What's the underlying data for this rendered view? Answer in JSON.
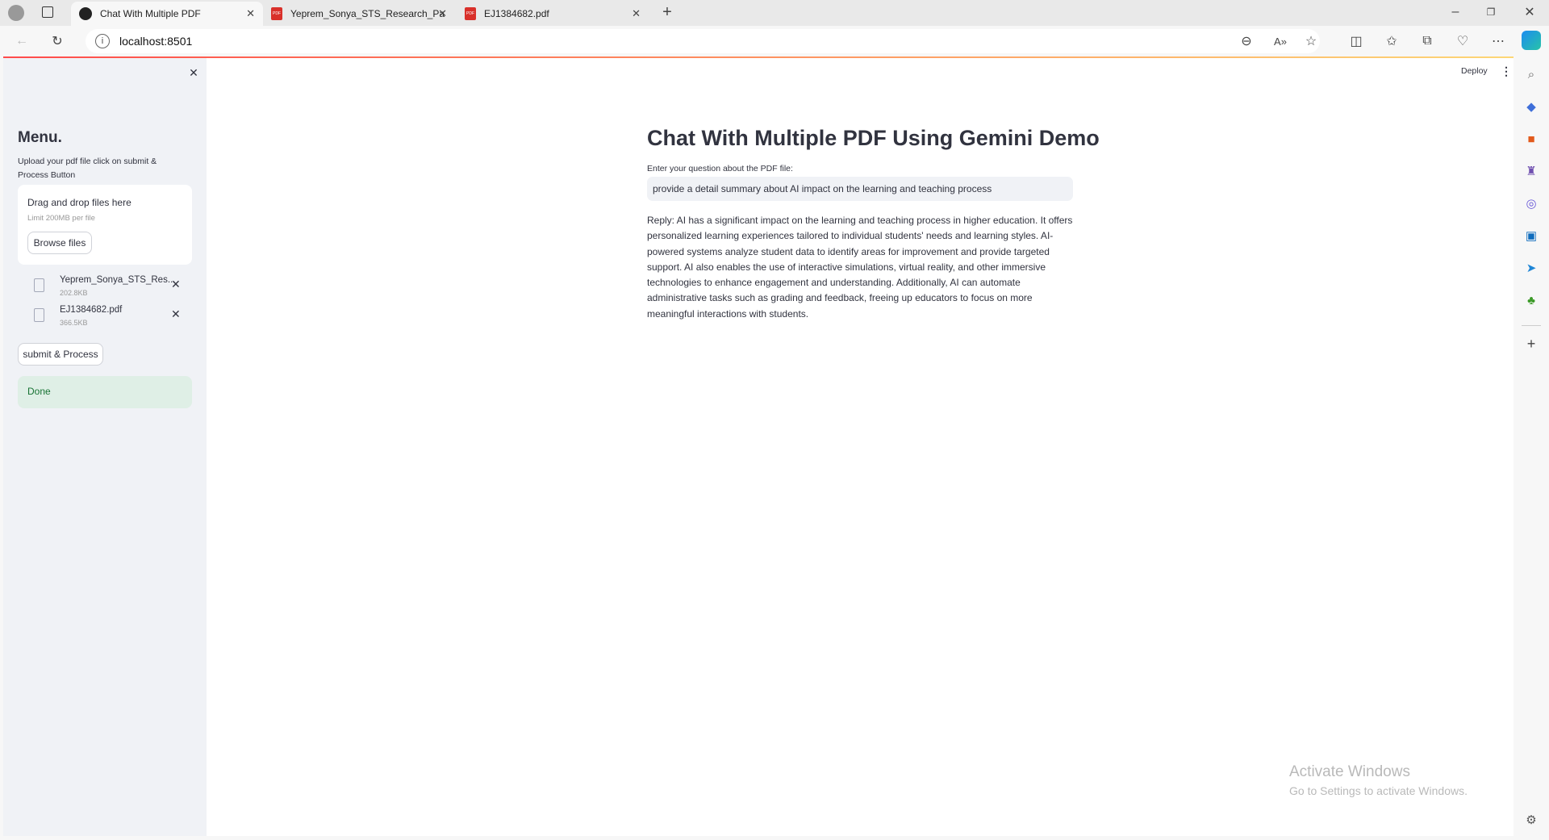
{
  "browser": {
    "tabs": [
      {
        "title": "Chat With Multiple PDF",
        "active": true
      },
      {
        "title": "Yeprem_Sonya_STS_Research_Pa",
        "active": false
      },
      {
        "title": "EJ1384682.pdf",
        "active": false
      }
    ],
    "url": "localhost:8501"
  },
  "header": {
    "deploy_label": "Deploy"
  },
  "sidebar": {
    "title": "Menu.",
    "instructions": "Upload your pdf file click on submit & Process Button",
    "uploader": {
      "drop_text": "Drag and drop files here",
      "limit_text": "Limit 200MB per file",
      "browse_label": "Browse files"
    },
    "files": [
      {
        "name": "Yeprem_Sonya_STS_Res...",
        "size": "202.8KB"
      },
      {
        "name": "EJ1384682.pdf",
        "size": "366.5KB"
      }
    ],
    "submit_label": "submit & Process",
    "status": "Done"
  },
  "main": {
    "title": "Chat With Multiple PDF Using Gemini Demo",
    "question_label": "Enter your question about the PDF file:",
    "question_value": "provide a detail summary about AI impact on the learning and teaching process",
    "reply": "Reply: AI has a significant impact on the learning and teaching process in higher education. It offers personalized learning experiences tailored to individual students' needs and learning styles. AI-powered systems analyze student data to identify areas for improvement and provide targeted support. AI also enables the use of interactive simulations, virtual reality, and other immersive technologies to enhance engagement and understanding. Additionally, AI can automate administrative tasks such as grading and feedback, freeing up educators to focus on more meaningful interactions with students."
  },
  "watermark": {
    "title": "Activate Windows",
    "subtitle": "Go to Settings to activate Windows."
  }
}
